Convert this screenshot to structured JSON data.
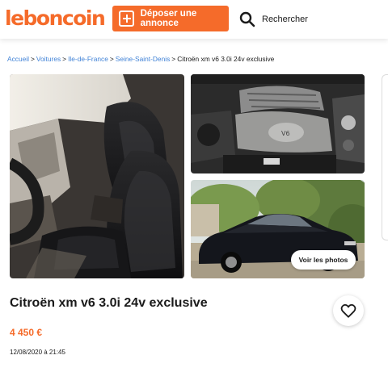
{
  "header": {
    "logo": "leboncoin",
    "post_button_label": "Déposer une annonce",
    "search_label": "Rechercher"
  },
  "breadcrumb": {
    "items": [
      "Accueil",
      "Voitures",
      "Ile-de-France",
      "Seine-Saint-Denis"
    ],
    "current": "Citroën xm v6 3.0i 24v exclusive"
  },
  "gallery": {
    "see_photos_label": "Voir les photos"
  },
  "listing": {
    "title": "Citroën xm v6 3.0i 24v exclusive",
    "price": "4 450 €",
    "date": "12/08/2020 à 21:45"
  },
  "colors": {
    "brand": "#f56b2a",
    "link": "#4183d7"
  },
  "icons": {
    "post": "plus-square-icon",
    "search": "magnifier-icon",
    "favorite": "heart-outline-icon"
  }
}
